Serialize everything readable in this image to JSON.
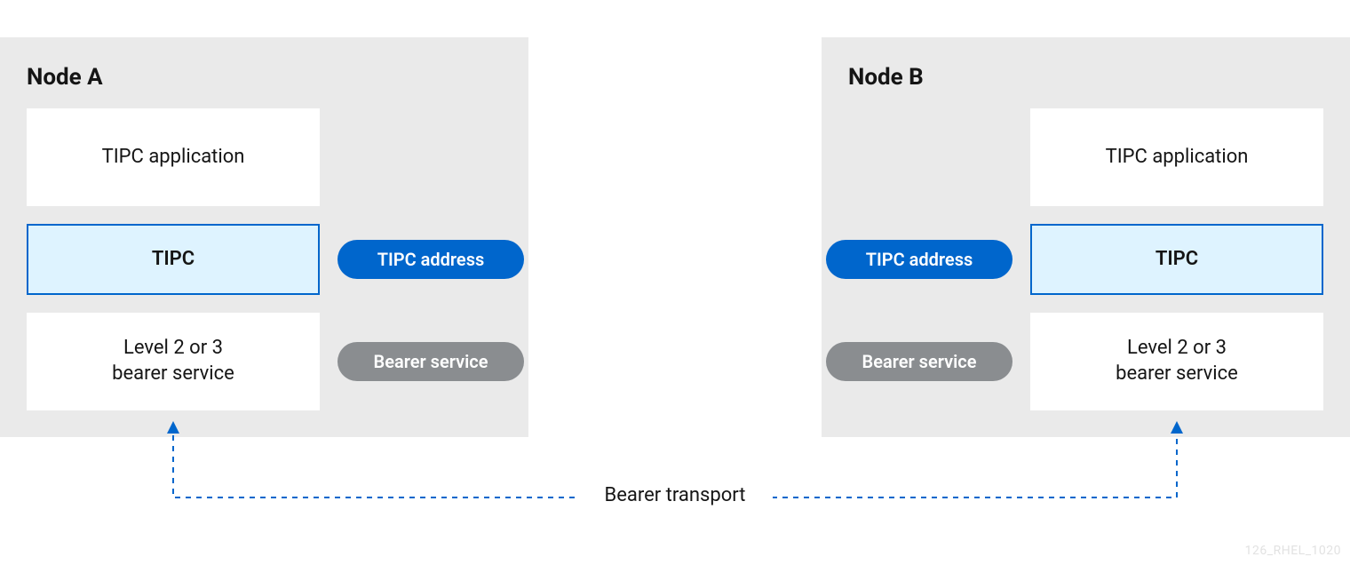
{
  "nodes": {
    "a": {
      "title": "Node A",
      "app": "TIPC application",
      "tipc": "TIPC",
      "bearer": "Level 2 or 3\nbearer service",
      "pill_tipc": "TIPC address",
      "pill_bearer": "Bearer service"
    },
    "b": {
      "title": "Node B",
      "app": "TIPC application",
      "tipc": "TIPC",
      "bearer": "Level 2 or 3\nbearer service",
      "pill_tipc": "TIPC address",
      "pill_bearer": "Bearer service"
    }
  },
  "transport_label": "Bearer transport",
  "watermark": "126_RHEL_1020",
  "colors": {
    "panel_bg": "#eaeaea",
    "tipc_border": "#0066cc",
    "tipc_fill": "#def3ff",
    "pill_blue": "#0066cc",
    "pill_gray": "#8a8d90",
    "connector": "#0066cc"
  }
}
